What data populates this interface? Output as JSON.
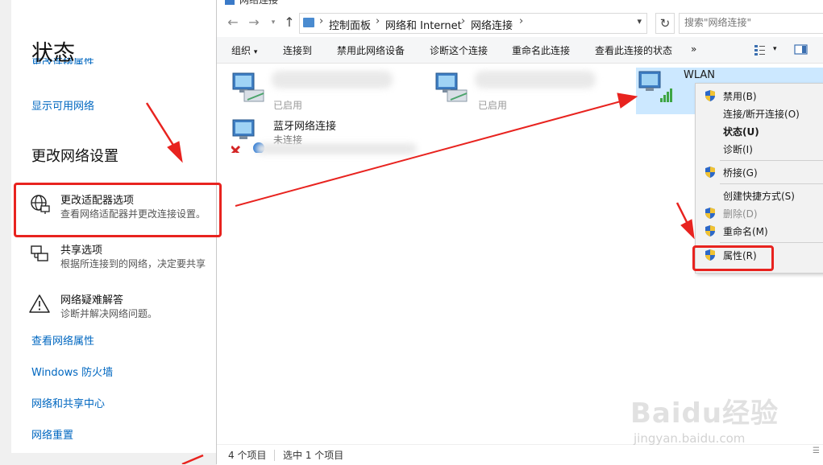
{
  "settings": {
    "title": "状态",
    "cut_link": "更改连接属性",
    "show_networks": "显示可用网络",
    "section_title": "更改网络设置",
    "options": [
      {
        "title": "更改适配器选项",
        "desc": "查看网络适配器并更改连接设置。",
        "icon": "globe-monitor-icon"
      },
      {
        "title": "共享选项",
        "desc": "根据所连接到的网络，决定要共享",
        "icon": "sharing-icon"
      },
      {
        "title": "网络疑难解答",
        "desc": "诊断并解决网络问题。",
        "icon": "warning-icon"
      }
    ],
    "links": [
      "查看网络属性",
      "Windows 防火墙",
      "网络和共享中心",
      "网络重置"
    ]
  },
  "explorer": {
    "window_title": "网络连接",
    "breadcrumb": [
      "控制面板",
      "网络和 Internet",
      "网络连接"
    ],
    "search_placeholder": "搜索\"网络连接\"",
    "toolbar": {
      "organize": "组织",
      "connect_to": "连接到",
      "disable_device": "禁用此网络设备",
      "diagnose": "诊断这个连接",
      "rename": "重命名此连接",
      "view_status": "查看此连接的状态",
      "more": "»"
    },
    "items": [
      {
        "name": "",
        "status": "已启用"
      },
      {
        "name": "",
        "status": "已启用"
      },
      {
        "name": "WLAN",
        "status": ""
      },
      {
        "name": "蓝牙网络连接",
        "status": "未连接"
      }
    ],
    "status_count": "4 个项目",
    "status_selected": "选中 1 个项目"
  },
  "context_menu": [
    {
      "label": "禁用(B)",
      "shield": true,
      "disabled": false,
      "bold": false
    },
    {
      "label": "连接/断开连接(O)",
      "shield": false,
      "disabled": false,
      "bold": false
    },
    {
      "label": "状态(U)",
      "shield": false,
      "disabled": false,
      "bold": true
    },
    {
      "label": "诊断(I)",
      "shield": false,
      "disabled": false,
      "bold": false
    },
    {
      "label": "桥接(G)",
      "shield": true,
      "disabled": false,
      "bold": false
    },
    {
      "label": "创建快捷方式(S)",
      "shield": false,
      "disabled": false,
      "bold": false
    },
    {
      "label": "删除(D)",
      "shield": true,
      "disabled": true,
      "bold": false
    },
    {
      "label": "重命名(M)",
      "shield": true,
      "disabled": false,
      "bold": false
    },
    {
      "label": "属性(R)",
      "shield": true,
      "disabled": false,
      "bold": false
    }
  ],
  "annotation_color": "#e8231f",
  "accent_link_color": "#0067c0",
  "selection_color": "#cce8ff",
  "watermark": {
    "logo": "Baidu经验",
    "url": "jingyan.baidu.com"
  }
}
